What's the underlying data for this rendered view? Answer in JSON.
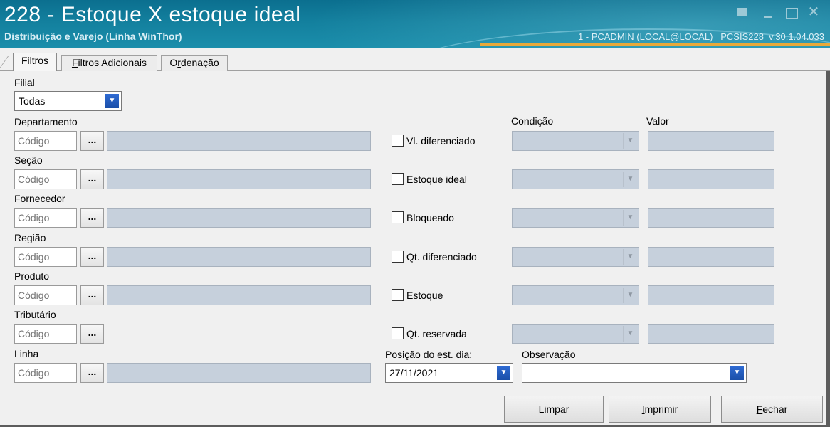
{
  "window": {
    "title": "228 - Estoque X estoque ideal",
    "subtitle": "Distribuição e Varejo (Linha WinThor)",
    "session": "1 - PCADMIN (LOCAL@LOCAL)   PCSIS228  v.30.1.04.033"
  },
  "tabs": [
    {
      "label_first": "F",
      "label_rest": "iltros",
      "active": true
    },
    {
      "label_first": "F",
      "label_rest": "iltros Adicionais",
      "active": false
    },
    {
      "label_pre": "O",
      "label_ul": "r",
      "label_rest": "denação",
      "active": false
    }
  ],
  "filial": {
    "label": "Filial",
    "value": "Todas"
  },
  "filters": [
    {
      "label": "Departamento",
      "code_placeholder": "Código",
      "button": "..."
    },
    {
      "label": "Seção",
      "code_placeholder": "Código",
      "button": "..."
    },
    {
      "label": "Fornecedor",
      "code_placeholder": "Código",
      "button": "..."
    },
    {
      "label": "Região",
      "code_placeholder": "Código",
      "button": "..."
    },
    {
      "label": "Produto",
      "code_placeholder": "Código",
      "button": "..."
    },
    {
      "label": "Tributário",
      "code_placeholder": "Código",
      "button": "..."
    },
    {
      "label": "Linha",
      "code_placeholder": "Código",
      "button": "..."
    }
  ],
  "conditions_header": {
    "condicao": "Condição",
    "valor": "Valor"
  },
  "conditions": [
    {
      "label": "Vl. diferenciado",
      "checked": false
    },
    {
      "label": "Estoque ideal",
      "checked": false
    },
    {
      "label": "Bloqueado",
      "checked": false
    },
    {
      "label": "Qt. diferenciado",
      "checked": false
    },
    {
      "label": "Estoque",
      "checked": false
    },
    {
      "label": "Qt. reservada",
      "checked": false
    }
  ],
  "posicao": {
    "label": "Posição do est. dia:",
    "value": "27/11/2021"
  },
  "observacao": {
    "label": "Observação",
    "value": ""
  },
  "actions": {
    "limpar": "Limpar",
    "imprimir_ul": "I",
    "imprimir_pre": "",
    "imprimir_rest": "mprimir",
    "fechar_ul": "F",
    "fechar_rest": "echar"
  },
  "colors": {
    "titlebar": "#13809e",
    "accent_line": "#e8a93a",
    "disabled_field": "#c6d0dc",
    "combo_arrow": "#2f6bd3"
  }
}
